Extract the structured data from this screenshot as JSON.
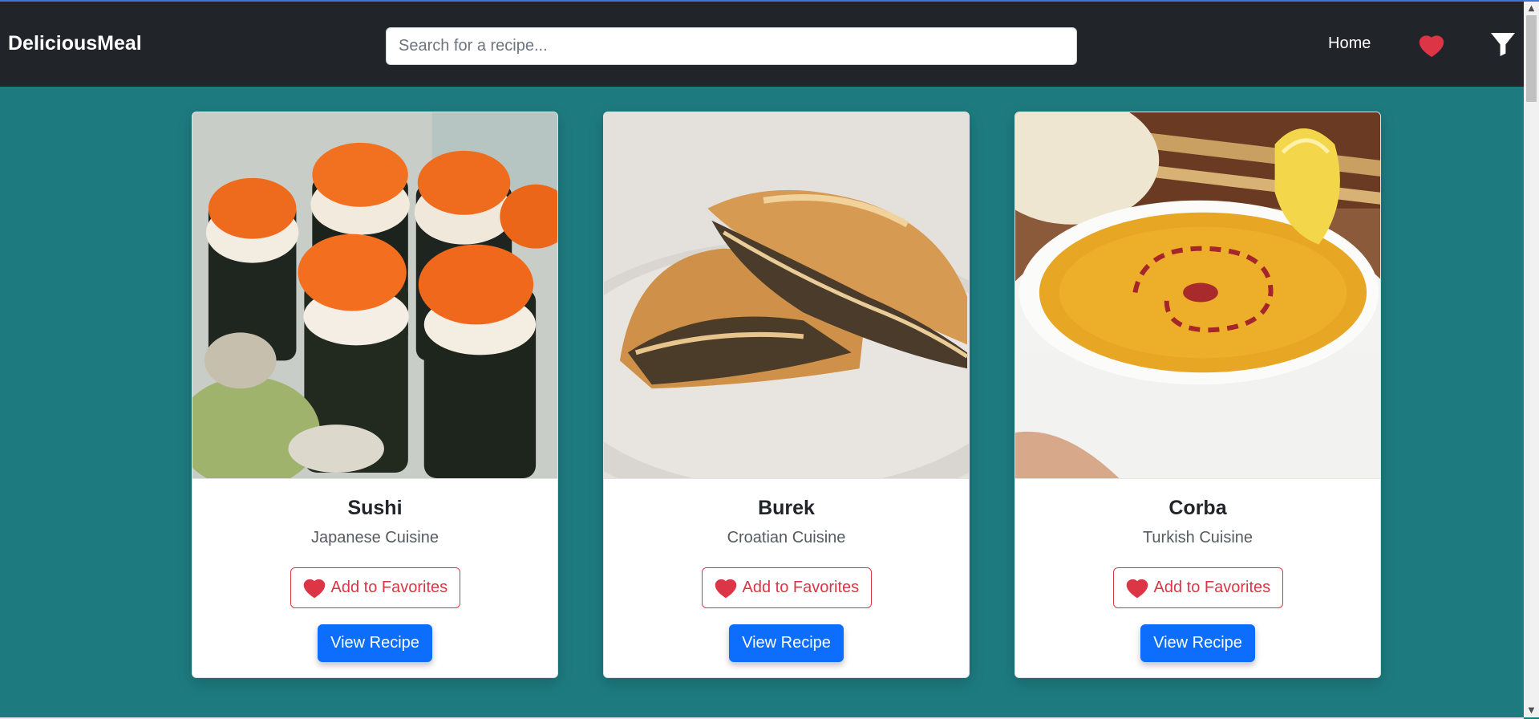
{
  "header": {
    "brand": "DeliciousMeal",
    "search_placeholder": "Search for a recipe...",
    "nav_home": "Home",
    "favorites_icon": "heart-icon",
    "filter_icon": "filter-icon"
  },
  "cards": [
    {
      "title": "Sushi",
      "cuisine": "Japanese Cuisine",
      "favorite_label": "Add to Favorites",
      "view_label": "View Recipe",
      "image": "sushi-photo"
    },
    {
      "title": "Burek",
      "cuisine": "Croatian Cuisine",
      "favorite_label": "Add to Favorites",
      "view_label": "View Recipe",
      "image": "burek-photo"
    },
    {
      "title": "Corba",
      "cuisine": "Turkish Cuisine",
      "favorite_label": "Add to Favorites",
      "view_label": "View Recipe",
      "image": "corba-photo"
    }
  ],
  "colors": {
    "navbar": "#212529",
    "page_background": "#1d7b7f",
    "favorite_red": "#dc3545",
    "primary_blue": "#0d6efd"
  }
}
